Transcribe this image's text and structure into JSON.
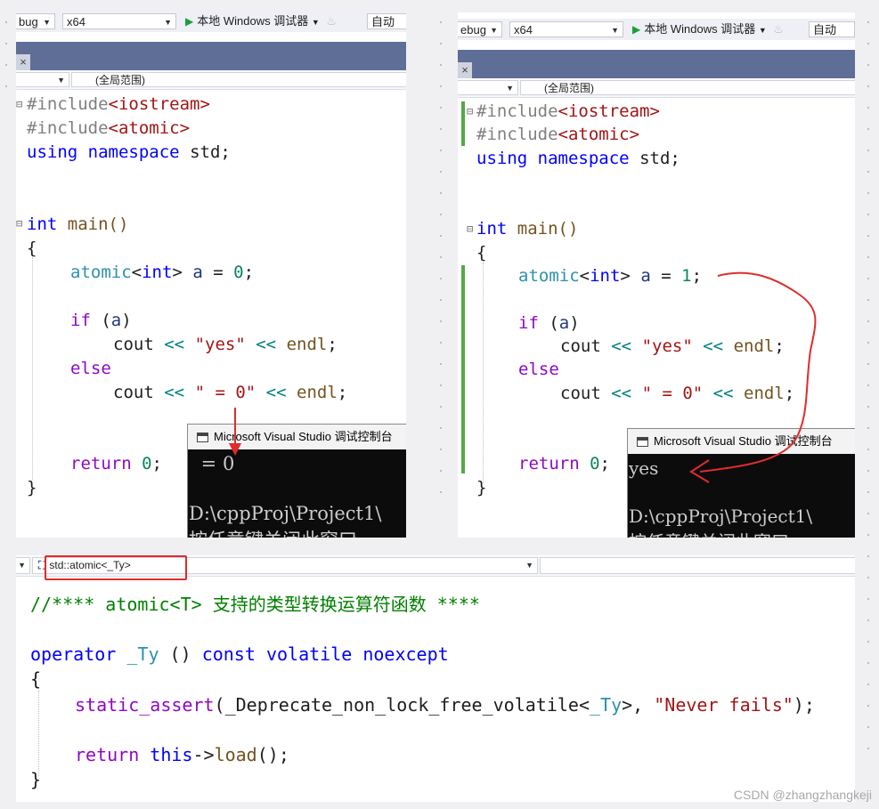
{
  "left_panel": {
    "toolbar": {
      "config": "bug",
      "platform": "x64",
      "debugger": "本地 Windows 调试器",
      "auto": "自动"
    },
    "tab_close": "×",
    "scope": "(全局范围)",
    "console": {
      "title": "Microsoft Visual Studio 调试控制台",
      "output": " = 0",
      "path": "D:\\cppProj\\Project1\\",
      "msg": "按任意键关闭此窗口"
    },
    "lines": [
      [
        "#include",
        "<iostream>"
      ],
      [
        "#include",
        "<atomic>"
      ],
      [
        "using",
        "namespace",
        "std;"
      ],
      [
        "int",
        "main()"
      ],
      [
        "{"
      ],
      [
        "atomic",
        "<",
        "int",
        ">",
        "a",
        "=",
        "0",
        ";"
      ],
      [
        "if",
        "(",
        "a",
        ")"
      ],
      [
        "cout",
        "<<",
        "\"yes\"",
        "<<",
        "endl",
        ";"
      ],
      [
        "else"
      ],
      [
        "cout",
        "<<",
        "\" = 0\"",
        "<<",
        "endl",
        ";"
      ],
      [
        "return",
        "0",
        ";"
      ],
      [
        "}"
      ]
    ]
  },
  "right_panel": {
    "toolbar": {
      "config": "ebug",
      "platform": "x64",
      "debugger": "本地 Windows 调试器",
      "auto": "自动"
    },
    "tab_close": "×",
    "scope": "(全局范围)",
    "console": {
      "title": "Microsoft Visual Studio 调试控制台",
      "output": "yes",
      "path": "D:\\cppProj\\Project1\\",
      "msg": "按任意键关闭此窗口"
    },
    "lines": [
      [
        "#include",
        "<iostream>"
      ],
      [
        "#include",
        "<atomic>"
      ],
      [
        "using",
        "namespace",
        "std;"
      ],
      [
        "int",
        "main()"
      ],
      [
        "{"
      ],
      [
        "atomic",
        "<",
        "int",
        ">",
        "a",
        "=",
        "1",
        ";"
      ],
      [
        "if",
        "(",
        "a",
        ")"
      ],
      [
        "cout",
        "<<",
        "\"yes\"",
        "<<",
        "endl",
        ";"
      ],
      [
        "else"
      ],
      [
        "cout",
        "<<",
        "\" = 0\"",
        "<<",
        "endl",
        ";"
      ],
      [
        "return",
        "0",
        ";"
      ],
      [
        "}"
      ]
    ]
  },
  "bottom_panel": {
    "scope": "std::atomic<_Ty>",
    "comment": "//**** atomic<T> 支持的类型转换运算符函数 ****",
    "op_line": [
      "operator",
      "_Ty",
      "()",
      "const",
      "volatile",
      "noexcept"
    ],
    "brace_open": "{",
    "assert_line": [
      "static_assert",
      "(",
      "_Deprecate_non_lock_free_volatile",
      "<",
      "_Ty",
      ">, ",
      "\"Never fails\"",
      ");"
    ],
    "return_line": [
      "return",
      "this",
      "->",
      "load",
      "();"
    ],
    "brace_close": "}"
  },
  "watermark": "CSDN @zhangzhangkeji",
  "colors": {
    "keyword": "#0000ff",
    "control": "#8f08c4",
    "string": "#a31515",
    "type": "#2b91af",
    "comment": "#008000",
    "annotation": "#e12b2b"
  }
}
